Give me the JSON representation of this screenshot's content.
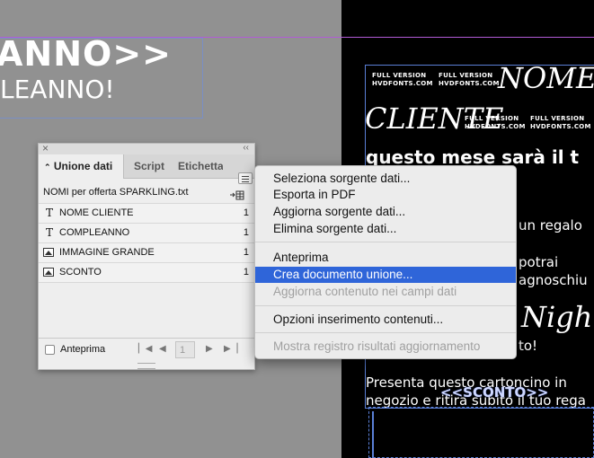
{
  "document": {
    "left_heading": "ANNO>>",
    "left_subheading": "LEANNO!",
    "font_badges": [
      [
        "FULL VERSION",
        "HVDFONTS.COM"
      ],
      [
        "FULL VERSION",
        "HVDFONTS.COM"
      ],
      [
        "FULL VERSION",
        "HVDFONTS.COM"
      ],
      [
        "FULL VERSION",
        "HVDFONTS.COM"
      ]
    ],
    "script_nome": "NOME",
    "script_cliente": "CLIENTE",
    "bold_line": "questo mese sarà il t",
    "line_regalo": "un regalo",
    "line_potrai": "potrai",
    "line_bagnoschiuma": "agnoschiu",
    "script_night": "Night",
    "line_to": "to!",
    "line_presenta": "Presenta questo cartoncino in",
    "line_negozio": "negozio e ritira subito il tuo rega",
    "sconto_tag": "<<SCONTO>>"
  },
  "panel": {
    "close_glyph": "×",
    "collapse_glyph": "‹‹",
    "tabs": [
      {
        "label": "Unione dati",
        "prefix": "⌃"
      },
      {
        "label": "Script"
      },
      {
        "label": "Etichetta"
      }
    ],
    "file_name": "NOMI per offerta SPARKLING.txt",
    "fields": [
      {
        "icon": "T",
        "label": "NOME CLIENTE",
        "value": "1"
      },
      {
        "icon": "T",
        "label": "COMPLEANNO",
        "value": "1"
      },
      {
        "icon": "image",
        "label": "IMMAGINE GRANDE",
        "value": "1"
      },
      {
        "icon": "image",
        "label": "SCONTO",
        "value": "1"
      }
    ],
    "preview_label": "Anteprima",
    "page_number": "1"
  },
  "menu": {
    "items": [
      {
        "label": "Seleziona sorgente dati...",
        "state": "normal"
      },
      {
        "label": "Esporta in PDF",
        "state": "normal"
      },
      {
        "label": "Aggiorna sorgente dati...",
        "state": "normal"
      },
      {
        "label": "Elimina sorgente dati...",
        "state": "normal"
      },
      {
        "label": "Anteprima",
        "state": "normal"
      },
      {
        "label": "Crea documento unione...",
        "state": "selected"
      },
      {
        "label": "Aggiorna contenuto nei campi dati",
        "state": "disabled"
      },
      {
        "label": "Opzioni inserimento contenuti...",
        "state": "normal"
      },
      {
        "label": "Mostra registro risultati aggiornamento",
        "state": "disabled"
      }
    ]
  },
  "colors": {
    "selection": "#2f65d9",
    "frame_blue": "#5a7fd6",
    "guide_purple": "#b25bd6"
  }
}
